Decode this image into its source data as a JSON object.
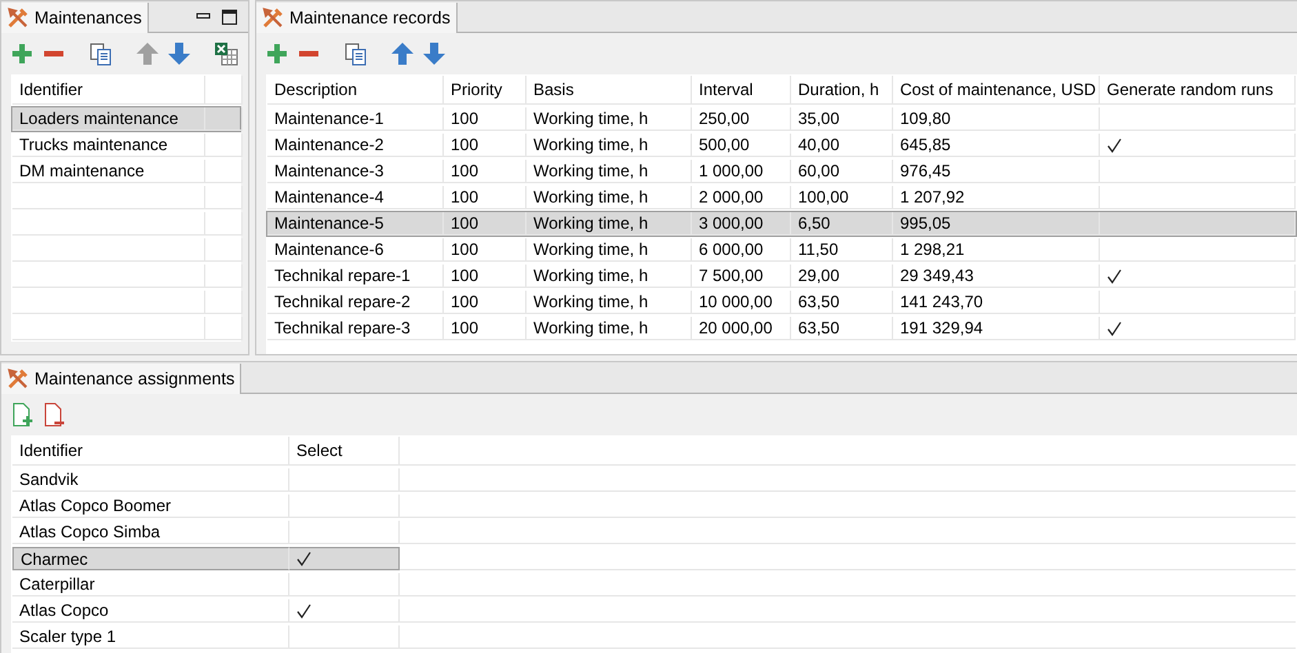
{
  "maintenances_panel": {
    "tab": "Maintenances",
    "toolbar": [
      {
        "kind": "add",
        "disabled": false
      },
      {
        "kind": "remove",
        "disabled": false
      },
      {
        "kind": "copy",
        "disabled": false
      },
      {
        "kind": "up",
        "disabled": true
      },
      {
        "kind": "down",
        "disabled": false
      },
      {
        "kind": "export",
        "disabled": false
      }
    ],
    "columns": [
      "Identifier"
    ],
    "rows": [
      {
        "identifier": "Loaders maintenance",
        "selected": true
      },
      {
        "identifier": "Trucks maintenance",
        "selected": false
      },
      {
        "identifier": "DM maintenance",
        "selected": false
      }
    ]
  },
  "records_panel": {
    "tab": "Maintenance records",
    "toolbar": [
      {
        "kind": "add",
        "disabled": false
      },
      {
        "kind": "remove",
        "disabled": false
      },
      {
        "kind": "copy",
        "disabled": false
      },
      {
        "kind": "up",
        "disabled": false
      },
      {
        "kind": "down",
        "disabled": false
      }
    ],
    "columns": [
      "Description",
      "Priority",
      "Basis",
      "Interval",
      "Duration, h",
      "Cost of maintenance, USD",
      "Generate random runs"
    ],
    "rows": [
      {
        "description": "Maintenance-1",
        "priority": "100",
        "basis": "Working time, h",
        "interval": "250,00",
        "duration": "35,00",
        "cost": "109,80",
        "generate_random_runs": false,
        "selected": false
      },
      {
        "description": "Maintenance-2",
        "priority": "100",
        "basis": "Working time, h",
        "interval": "500,00",
        "duration": "40,00",
        "cost": "645,85",
        "generate_random_runs": true,
        "selected": false
      },
      {
        "description": "Maintenance-3",
        "priority": "100",
        "basis": "Working time, h",
        "interval": "1 000,00",
        "duration": "60,00",
        "cost": "976,45",
        "generate_random_runs": false,
        "selected": false
      },
      {
        "description": "Maintenance-4",
        "priority": "100",
        "basis": "Working time, h",
        "interval": "2 000,00",
        "duration": "100,00",
        "cost": "1 207,92",
        "generate_random_runs": false,
        "selected": false
      },
      {
        "description": "Maintenance-5",
        "priority": "100",
        "basis": "Working time, h",
        "interval": "3 000,00",
        "duration": "6,50",
        "cost": "995,05",
        "generate_random_runs": false,
        "selected": true
      },
      {
        "description": "Maintenance-6",
        "priority": "100",
        "basis": "Working time, h",
        "interval": "6 000,00",
        "duration": "11,50",
        "cost": "1 298,21",
        "generate_random_runs": false,
        "selected": false
      },
      {
        "description": "Technikal repare-1",
        "priority": "100",
        "basis": "Working time, h",
        "interval": "7 500,00",
        "duration": "29,00",
        "cost": "29 349,43",
        "generate_random_runs": true,
        "selected": false
      },
      {
        "description": "Technikal repare-2",
        "priority": "100",
        "basis": "Working time, h",
        "interval": "10 000,00",
        "duration": "63,50",
        "cost": "141 243,70",
        "generate_random_runs": false,
        "selected": false
      },
      {
        "description": "Technikal repare-3",
        "priority": "100",
        "basis": "Working time, h",
        "interval": "20 000,00",
        "duration": "63,50",
        "cost": "191 329,94",
        "generate_random_runs": true,
        "selected": false
      }
    ]
  },
  "assignments_panel": {
    "tab": "Maintenance assignments",
    "toolbar": [
      {
        "kind": "new-doc",
        "disabled": false
      },
      {
        "kind": "delete-doc",
        "disabled": false
      }
    ],
    "columns": [
      "Identifier",
      "Select"
    ],
    "rows": [
      {
        "identifier": "Sandvik",
        "select": false,
        "selected": false
      },
      {
        "identifier": "Atlas Copco Boomer",
        "select": false,
        "selected": false
      },
      {
        "identifier": "Atlas Copco Simba",
        "select": false,
        "selected": false
      },
      {
        "identifier": "Charmec",
        "select": true,
        "selected": true
      },
      {
        "identifier": "Caterpillar",
        "select": false,
        "selected": false
      },
      {
        "identifier": "Atlas Copco",
        "select": true,
        "selected": false
      },
      {
        "identifier": "Scaler type 1",
        "select": false,
        "selected": false
      }
    ]
  }
}
